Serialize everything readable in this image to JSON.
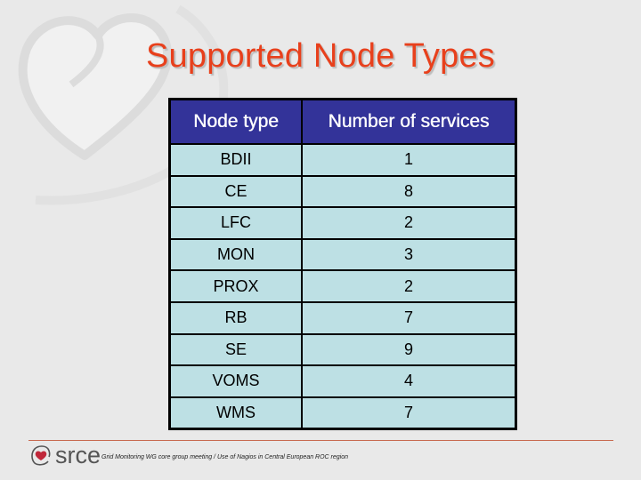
{
  "slide": {
    "title": "Supported Node Types",
    "colors": {
      "title": "#e8401c",
      "header_bg": "#333399",
      "cell_bg": "#bde0e4",
      "footer_rule": "#c86a50"
    }
  },
  "table": {
    "headers": [
      "Node type",
      "Number of services"
    ],
    "rows": [
      {
        "node_type": "BDII",
        "services": "1"
      },
      {
        "node_type": "CE",
        "services": "8"
      },
      {
        "node_type": "LFC",
        "services": "2"
      },
      {
        "node_type": "MON",
        "services": "3"
      },
      {
        "node_type": "PROX",
        "services": "2"
      },
      {
        "node_type": "RB",
        "services": "7"
      },
      {
        "node_type": "SE",
        "services": "9"
      },
      {
        "node_type": "VOMS",
        "services": "4"
      },
      {
        "node_type": "WMS",
        "services": "7"
      }
    ]
  },
  "footer": {
    "logo_icon": "heart-at-icon",
    "brand": "srce",
    "text": "Grid Monitoring WG core group meeting / Use of Nagios in Central European ROC region"
  }
}
